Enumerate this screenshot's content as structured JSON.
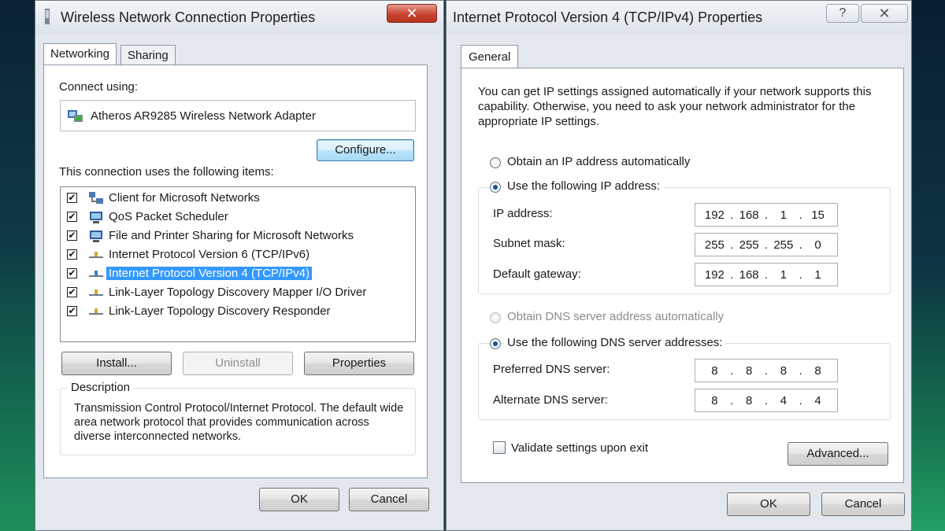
{
  "left_window": {
    "title": "Wireless Network Connection Properties",
    "close_label": "✕",
    "tabs": [
      {
        "label": "Networking"
      },
      {
        "label": "Sharing"
      }
    ],
    "connect_using_label": "Connect using:",
    "adapter_name": "Atheros AR9285 Wireless Network Adapter",
    "configure_label": "Configure...",
    "items_label": "This connection uses the following items:",
    "items": [
      {
        "label": "Client for Microsoft Networks",
        "checked": true,
        "icon": "network-client-icon"
      },
      {
        "label": "QoS Packet Scheduler",
        "checked": true,
        "icon": "service-icon"
      },
      {
        "label": "File and Printer Sharing for Microsoft Networks",
        "checked": true,
        "icon": "service-icon"
      },
      {
        "label": "Internet Protocol Version 6 (TCP/IPv6)",
        "checked": true,
        "icon": "protocol-icon"
      },
      {
        "label": "Internet Protocol Version 4 (TCP/IPv4)",
        "checked": true,
        "icon": "protocol-icon",
        "selected": true
      },
      {
        "label": "Link-Layer Topology Discovery Mapper I/O Driver",
        "checked": true,
        "icon": "protocol-icon"
      },
      {
        "label": "Link-Layer Topology Discovery Responder",
        "checked": true,
        "icon": "protocol-icon"
      }
    ],
    "install_label": "Install...",
    "uninstall_label": "Uninstall",
    "properties_label": "Properties",
    "description_title": "Description",
    "description_text": "Transmission Control Protocol/Internet Protocol. The default wide area network protocol that provides communication across diverse interconnected networks.",
    "ok_label": "OK",
    "cancel_label": "Cancel"
  },
  "right_window": {
    "title": "Internet Protocol Version 4 (TCP/IPv4) Properties",
    "help_label": "?",
    "close_label": "✕",
    "tab_general": "General",
    "info_text": "You can get IP settings assigned automatically if your network supports this capability. Otherwise, you need to ask your network administrator for the appropriate IP settings.",
    "obtain_ip_auto": "Obtain an IP address automatically",
    "use_following_ip": "Use the following IP address:",
    "ip_address_label": "IP address:",
    "ip_address": [
      "192",
      "168",
      "1",
      "15"
    ],
    "subnet_mask_label": "Subnet mask:",
    "subnet_mask": [
      "255",
      "255",
      "255",
      "0"
    ],
    "default_gateway_label": "Default gateway:",
    "default_gateway": [
      "192",
      "168",
      "1",
      "1"
    ],
    "obtain_dns_auto": "Obtain DNS server address automatically",
    "use_following_dns": "Use the following DNS server addresses:",
    "preferred_dns_label": "Preferred DNS server:",
    "preferred_dns": [
      "8",
      "8",
      "8",
      "8"
    ],
    "alternate_dns_label": "Alternate DNS server:",
    "alternate_dns": [
      "8",
      "8",
      "4",
      "4"
    ],
    "validate_label": "Validate settings upon exit",
    "advanced_label": "Advanced...",
    "ok_label": "OK",
    "cancel_label": "Cancel"
  }
}
